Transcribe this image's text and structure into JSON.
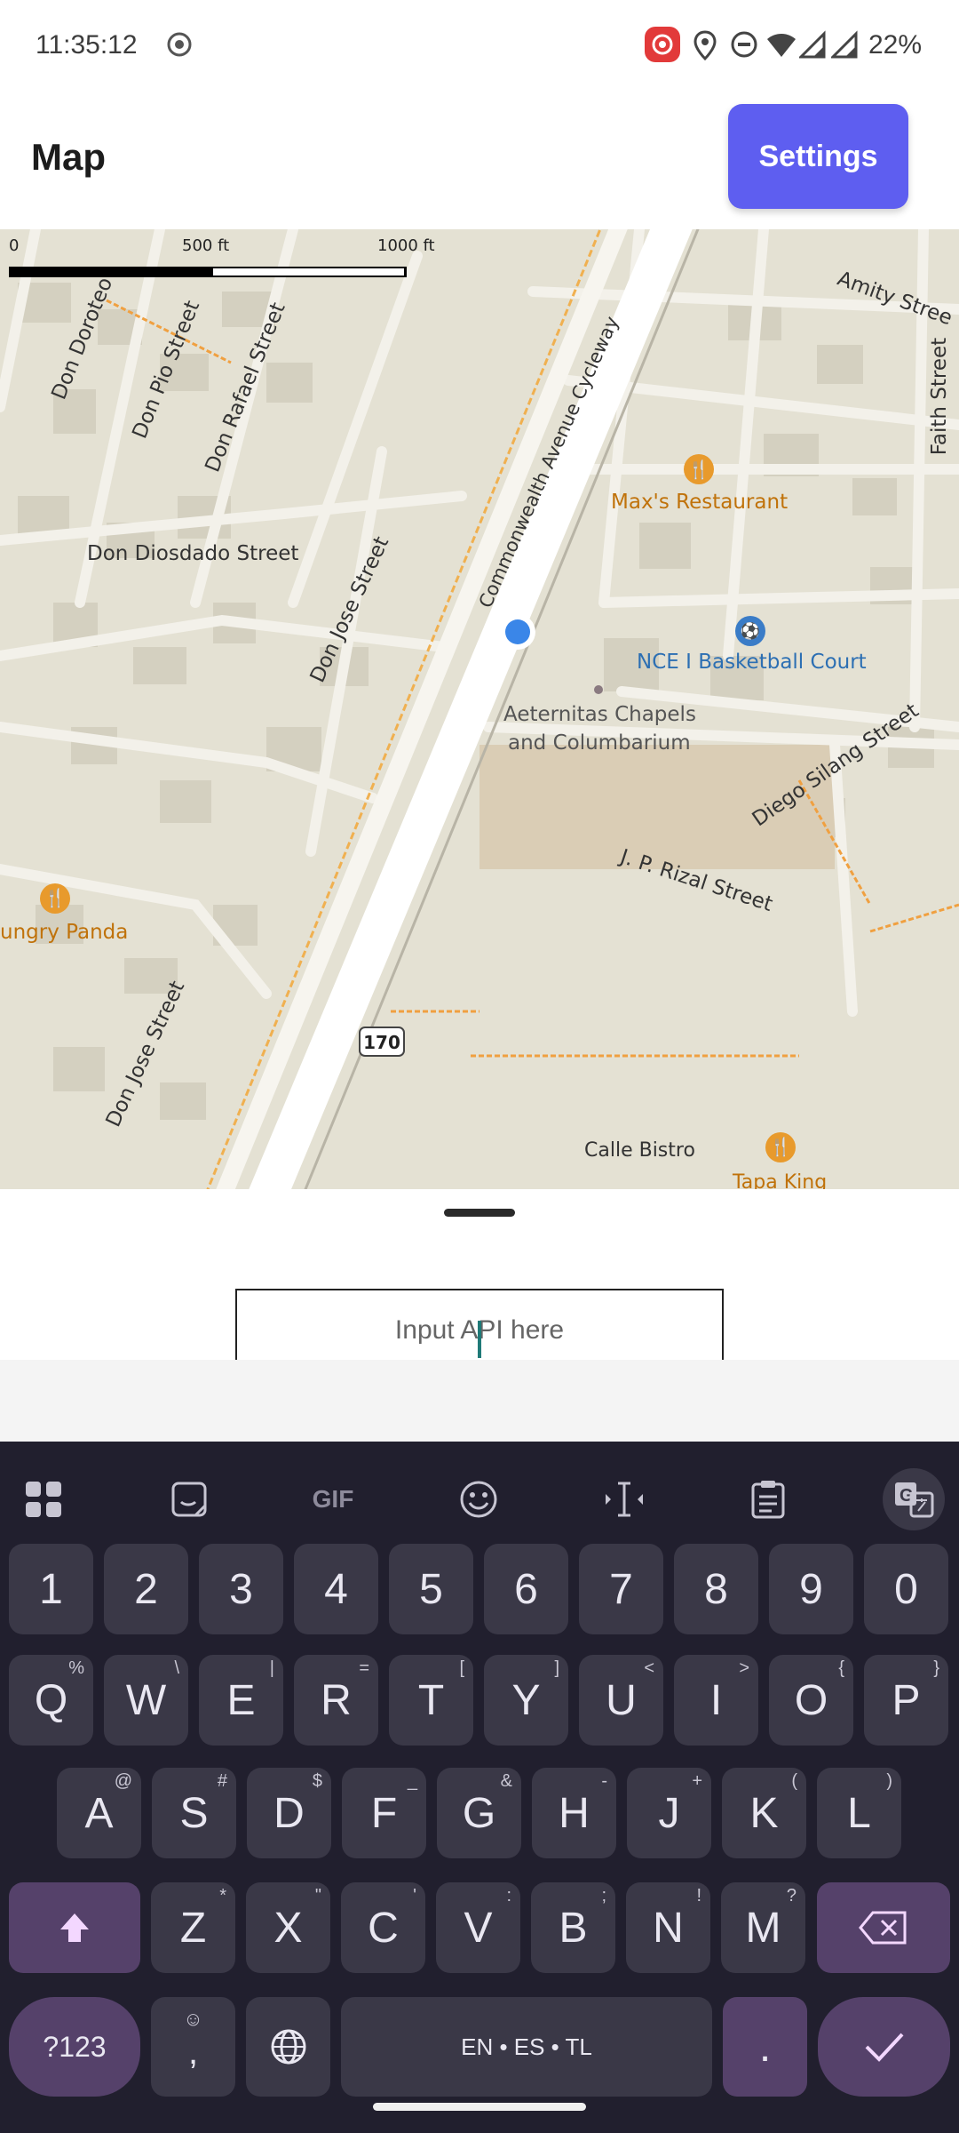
{
  "status_bar": {
    "time": "11:35:12",
    "battery": "22%",
    "icons": [
      "screen-record-icon",
      "record-indicator-icon",
      "location-icon",
      "do-not-disturb-icon",
      "wifi-icon",
      "signal-icon",
      "signal-icon-2"
    ]
  },
  "app_bar": {
    "title": "Map",
    "settings_label": "Settings",
    "accent": "#5e5ef0"
  },
  "map": {
    "scale": {
      "zero": "0",
      "mid": "500 ft",
      "max": "1000 ft"
    },
    "streets": {
      "don_doroteo": "Don Doroteo",
      "don_pio": "Don Pio Street",
      "don_rafael": "Don Rafael Street",
      "don_diosdado": "Don Diosdado Street",
      "don_jose_1": "Don Jose Street",
      "don_jose_2": "Don Jose Street",
      "commonwealth": "Commonwealth Avenue Cycleway",
      "amity": "Amity Stree",
      "faith": "Faith Street",
      "diego_silang": "Diego Silang Street",
      "jp_rizal": "J. P. Rizal Street",
      "calle_bistro": "Calle Bistro"
    },
    "places": {
      "maxs": "Max's Restaurant",
      "nce_court": "NCE I Basketball Court",
      "chapels_line1": "Aeternitas Chapels",
      "chapels_line2": "and Columbarium",
      "hungry_panda": "ungry Panda",
      "tapa_king": "Tapa King"
    },
    "route_shield": "170"
  },
  "sheet": {
    "input_placeholder": "Input API here"
  },
  "keyboard": {
    "toolbar": [
      "apps-icon",
      "sticker-icon",
      "GIF",
      "emoji-icon",
      "cursor-move-icon",
      "clipboard-icon",
      "translate-icon"
    ],
    "gif_label": "GIF",
    "number_row": [
      "1",
      "2",
      "3",
      "4",
      "5",
      "6",
      "7",
      "8",
      "9",
      "0"
    ],
    "row1": [
      {
        "k": "Q",
        "s": "%"
      },
      {
        "k": "W",
        "s": "\\"
      },
      {
        "k": "E",
        "s": "|"
      },
      {
        "k": "R",
        "s": "="
      },
      {
        "k": "T",
        "s": "["
      },
      {
        "k": "Y",
        "s": "]"
      },
      {
        "k": "U",
        "s": "<"
      },
      {
        "k": "I",
        "s": ">"
      },
      {
        "k": "O",
        "s": "{"
      },
      {
        "k": "P",
        "s": "}"
      }
    ],
    "row2": [
      {
        "k": "A",
        "s": "@"
      },
      {
        "k": "S",
        "s": "#"
      },
      {
        "k": "D",
        "s": "$"
      },
      {
        "k": "F",
        "s": "_"
      },
      {
        "k": "G",
        "s": "&"
      },
      {
        "k": "H",
        "s": "-"
      },
      {
        "k": "J",
        "s": "+"
      },
      {
        "k": "K",
        "s": "("
      },
      {
        "k": "L",
        "s": ")"
      }
    ],
    "row3": [
      {
        "k": "Z",
        "s": "*"
      },
      {
        "k": "X",
        "s": "\""
      },
      {
        "k": "C",
        "s": "'"
      },
      {
        "k": "V",
        "s": ":"
      },
      {
        "k": "B",
        "s": ";"
      },
      {
        "k": "N",
        "s": "!"
      },
      {
        "k": "M",
        "s": "?"
      }
    ],
    "symbols_label": "?123",
    "comma_label": ",",
    "space_label": "EN • ES • TL",
    "period_label": "."
  }
}
